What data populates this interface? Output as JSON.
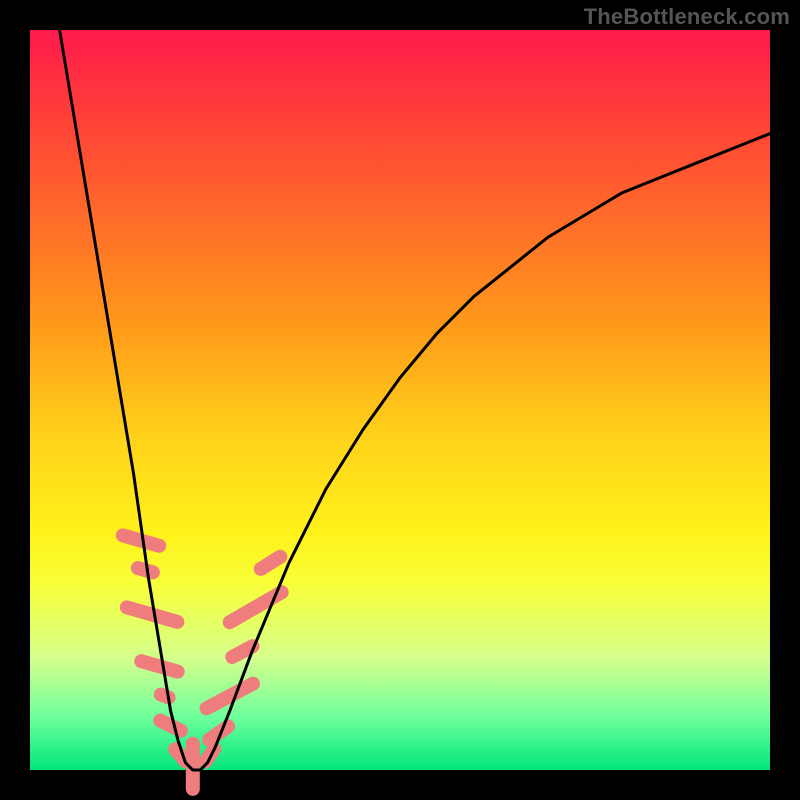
{
  "watermark": "TheBottleneck.com",
  "chart_data": {
    "type": "line",
    "title": "",
    "xlabel": "",
    "ylabel": "",
    "xlim": [
      0,
      100
    ],
    "ylim": [
      0,
      100
    ],
    "grid": false,
    "legend": false,
    "series": [
      {
        "name": "bottleneck-curve",
        "color": "#000000",
        "x": [
          4,
          6,
          8,
          10,
          12,
          13,
          14,
          15,
          16,
          17,
          18,
          19,
          20,
          21,
          22,
          23,
          24,
          25,
          27,
          30,
          35,
          40,
          45,
          50,
          55,
          60,
          65,
          70,
          75,
          80,
          85,
          90,
          95,
          100
        ],
        "y": [
          100,
          88,
          76,
          64,
          52,
          46,
          40,
          33,
          26,
          20,
          14,
          8,
          4,
          1,
          0,
          0,
          1,
          3,
          8,
          16,
          28,
          38,
          46,
          53,
          59,
          64,
          68,
          72,
          75,
          78,
          80,
          82,
          84,
          86
        ]
      }
    ],
    "markers": [
      {
        "name": "pink-segment",
        "shape": "pill",
        "color": "#ef7d7d",
        "points": [
          {
            "x": 15.0,
            "y": 31,
            "len": 7,
            "angle": -74
          },
          {
            "x": 15.6,
            "y": 27,
            "len": 4,
            "angle": -74
          },
          {
            "x": 16.5,
            "y": 21,
            "len": 9,
            "angle": -74
          },
          {
            "x": 17.5,
            "y": 14,
            "len": 7,
            "angle": -74
          },
          {
            "x": 18.2,
            "y": 10,
            "len": 3,
            "angle": -70
          },
          {
            "x": 19.0,
            "y": 6,
            "len": 5,
            "angle": -64
          },
          {
            "x": 20.3,
            "y": 2,
            "len": 4,
            "angle": -40
          },
          {
            "x": 22.0,
            "y": 0.5,
            "len": 8,
            "angle": 0
          },
          {
            "x": 24.3,
            "y": 2,
            "len": 4,
            "angle": 35
          },
          {
            "x": 25.5,
            "y": 5,
            "len": 5,
            "angle": 55
          },
          {
            "x": 27.0,
            "y": 10,
            "len": 9,
            "angle": 62
          },
          {
            "x": 28.7,
            "y": 16,
            "len": 5,
            "angle": 62
          },
          {
            "x": 30.5,
            "y": 22,
            "len": 10,
            "angle": 60
          },
          {
            "x": 32.5,
            "y": 28,
            "len": 5,
            "angle": 58
          }
        ]
      }
    ]
  }
}
